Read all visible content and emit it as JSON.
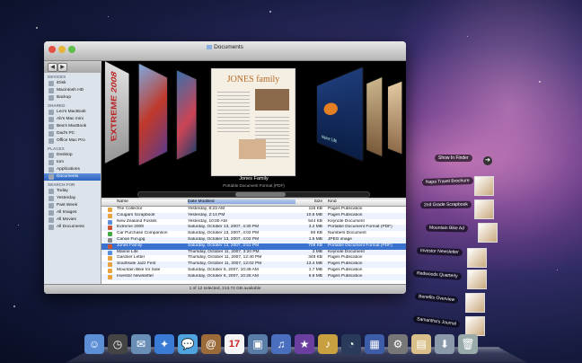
{
  "window": {
    "title": "Documents",
    "status": "1 of 12 selected, 213.74 GB available",
    "search_placeholder": "Q"
  },
  "sidebar": {
    "sections": [
      {
        "title": "DEVICES",
        "items": [
          "iDisk",
          "Macintosh HD",
          "Backup"
        ]
      },
      {
        "title": "SHARED",
        "items": [
          "Leo's MacBook",
          "Ab's Mac mini",
          "Bea's MacBook",
          "Dad's PC",
          "Office Mac Pro"
        ]
      },
      {
        "title": "PLACES",
        "items": [
          "Desktop",
          "tom",
          "Applications",
          "Documents"
        ]
      },
      {
        "title": "SEARCH FOR",
        "items": [
          "Today",
          "Yesterday",
          "Past Week",
          "All Images",
          "All Movies",
          "All Documents"
        ]
      }
    ],
    "selected": "Documents"
  },
  "coverflow": {
    "selected_name": "Jones Family",
    "selected_kind": "Portable Document Format (PDF)",
    "center_doc_title": "JONES family",
    "right_doc_label": "Marine Life",
    "left_doc_label": "EXTREME 2008"
  },
  "list": {
    "headers": {
      "name": "Name",
      "date": "Date Modified",
      "size": "Size",
      "kind": "Kind"
    },
    "rows": [
      {
        "name": "The Collector",
        "date": "Yesterday, 8:23 AM",
        "size": "116 KB",
        "kind": "Pages Publication",
        "color": "#e8a33a"
      },
      {
        "name": "Cougars Scrapbook",
        "date": "Yesterday, 2:14 PM",
        "size": "10.6 MB",
        "kind": "Pages Publication",
        "color": "#e8a33a"
      },
      {
        "name": "New Zealand Fossils",
        "date": "Yesterday, 10:00 AM",
        "size": "544 KB",
        "kind": "Keynote Document",
        "color": "#5b8ed8"
      },
      {
        "name": "Extreme 2008",
        "date": "Saturday, October 13, 2007, 4:30 PM",
        "size": "3.2 MB",
        "kind": "Portable Document Format (PDF)",
        "color": "#c53"
      },
      {
        "name": "Car Purchase Comparison",
        "date": "Saturday, October 13, 2007, 4:02 PM",
        "size": "60 KB",
        "kind": "Numbers Document",
        "color": "#4a4"
      },
      {
        "name": "Canoe Fun.jpg",
        "date": "Saturday, October 13, 2007, 4:02 PM",
        "size": "1.5 MB",
        "kind": "JPEG image",
        "color": "#888"
      },
      {
        "name": "Jones Family",
        "date": "Saturday, October 13, 2007, 3:51 PM",
        "size": "708 KB",
        "kind": "Portable Document Format (PDF)",
        "color": "#c53",
        "selected": true
      },
      {
        "name": "Marine Life",
        "date": "Thursday, October 11, 2007, 3:20 PM",
        "size": "3 MB",
        "kind": "Keynote Document",
        "color": "#5b8ed8"
      },
      {
        "name": "Gardner Letter",
        "date": "Thursday, October 11, 2007, 12:40 PM",
        "size": "348 KB",
        "kind": "Pages Publication",
        "color": "#e8a33a"
      },
      {
        "name": "Southside Jazz Fest",
        "date": "Thursday, October 11, 2007, 12:02 PM",
        "size": "13.4 MB",
        "kind": "Pages Publication",
        "color": "#e8a33a"
      },
      {
        "name": "Mountain Bike for Sale",
        "date": "Saturday, October 6, 2007, 10:49 AM",
        "size": "1.7 MB",
        "kind": "Pages Publication",
        "color": "#e8a33a"
      },
      {
        "name": "Investor Newsletter",
        "date": "Saturday, October 6, 2007, 10:25 AM",
        "size": "6.8 MB",
        "kind": "Pages Publication",
        "color": "#e8a33a"
      }
    ]
  },
  "stack": {
    "show_in_finder": "Show In Finder",
    "items": [
      "Napa Travel Brochure",
      "2nd Grade Scrapbook",
      "Mountain Bike Ad",
      "Investor Newsletter",
      "Redwoods Quarterly",
      "Benefits Overview",
      "Samantha's Journal"
    ]
  },
  "dock": {
    "icons": [
      "finder-icon",
      "dashboard-icon",
      "mail-icon",
      "safari-icon",
      "ichat-icon",
      "address-book-icon",
      "ical-icon",
      "iphoto-icon",
      "itunes-icon",
      "imovie-icon",
      "garageband-icon",
      "time-machine-icon",
      "spaces-icon",
      "system-preferences-icon",
      "documents-stack-icon",
      "downloads-stack-icon",
      "trash-icon"
    ],
    "ical_day": "17"
  }
}
